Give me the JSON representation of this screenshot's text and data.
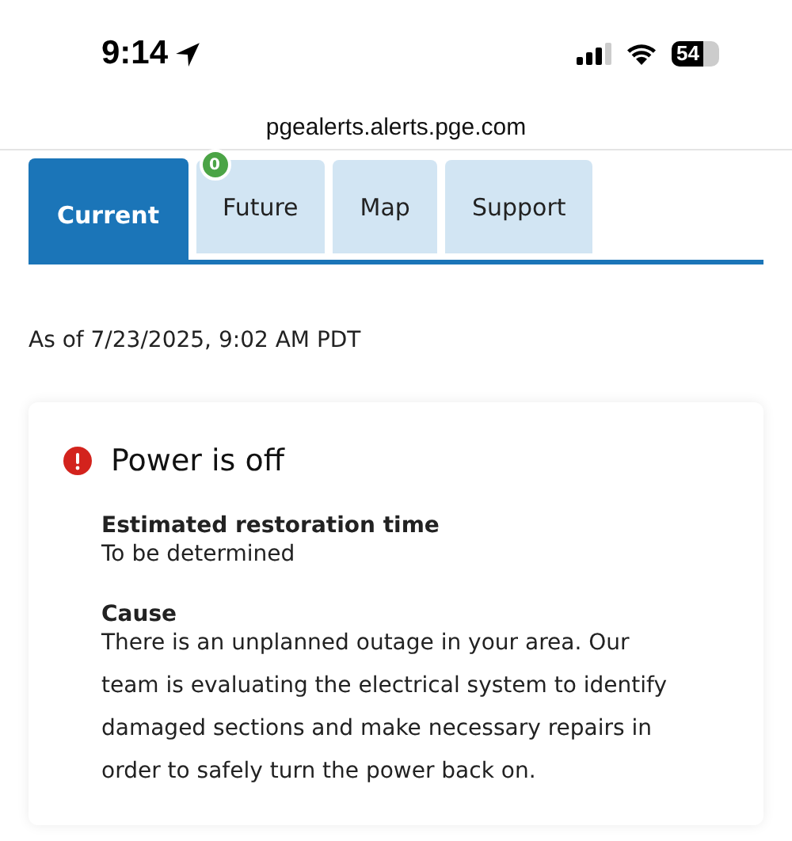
{
  "status_bar": {
    "time": "9:14",
    "battery": "54"
  },
  "address_bar": {
    "url": "pgealerts.alerts.pge.com"
  },
  "tabs": [
    {
      "label": "Current",
      "selected": true
    },
    {
      "label": "Future",
      "selected": false,
      "badge": "0"
    },
    {
      "label": "Map",
      "selected": false
    },
    {
      "label": "Support",
      "selected": false
    }
  ],
  "as_of": "As of 7/23/2025, 9:02 AM PDT",
  "alert": {
    "title": "Power is off",
    "sections": [
      {
        "label": "Estimated restoration time",
        "text": "To be determined"
      },
      {
        "label": "Cause",
        "text": "There is an unplanned outage in your area. Our team is evaluating the electrical system to identify damaged sections and make necessary repairs in order to safely turn the power back on."
      }
    ]
  }
}
